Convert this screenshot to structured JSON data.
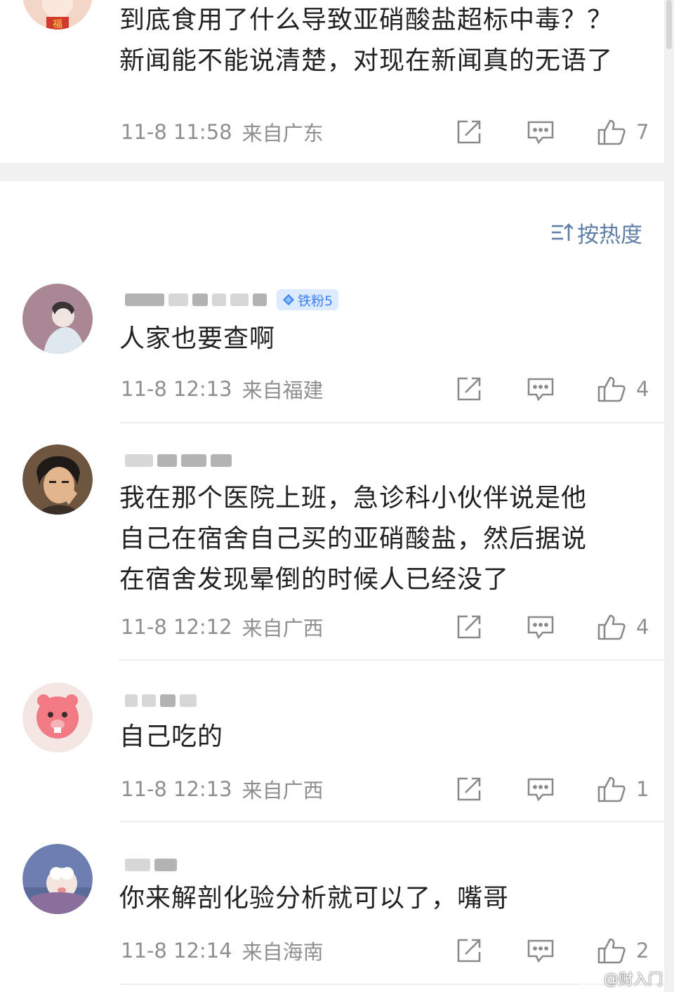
{
  "top_comment": {
    "text_line1": "到底食用了什么导致亚硝酸盐超标中毒？？",
    "text_line2": "新闻能不能说清楚，对现在新闻真的无语了",
    "time": "11-8 11:58",
    "location": "来自广东",
    "likes": "7"
  },
  "sort": {
    "label": "按热度",
    "icon": "sort-icon"
  },
  "comments": [
    {
      "badge": "铁粉5",
      "text": "人家也要查啊",
      "time": "11-8 12:13",
      "location": "来自福建",
      "likes": "4"
    },
    {
      "lines": [
        "我在那个医院上班，急诊科小伙伴说是他",
        "自己在宿舍自己买的亚硝酸盐，然后据说",
        "在宿舍发现晕倒的时候人已经没了"
      ],
      "time": "11-8 12:12",
      "location": "来自广西",
      "likes": "4"
    },
    {
      "text": "自己吃的",
      "time": "11-8 12:13",
      "location": "来自广西",
      "likes": "1"
    },
    {
      "text": "你来解剖化验分析就可以了，嘴哥",
      "time": "11-8 12:14",
      "location": "来自海南",
      "likes": "2"
    }
  ],
  "watermark": "@财入门",
  "colors": {
    "text": "#222222",
    "meta": "#8f8f8f",
    "sort": "#5f7fa6",
    "badge_bg": "#dcebff",
    "badge_text": "#3d82f0"
  }
}
